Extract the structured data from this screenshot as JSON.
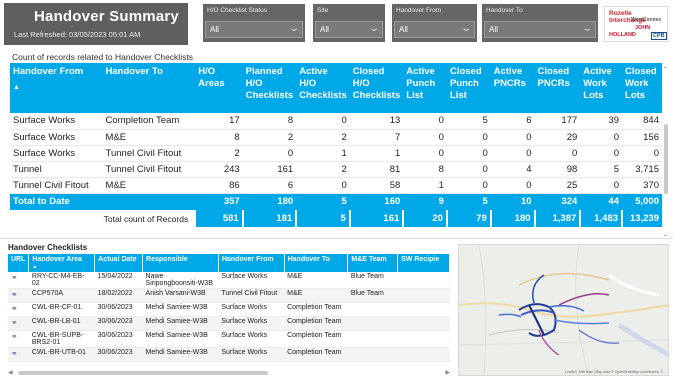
{
  "header": {
    "title": "Handover Summary",
    "last_refreshed": "Last Refreshed: 03/05/2023 05:01 AM",
    "filters": [
      {
        "label": "H/O Checklist Status",
        "value": "All"
      },
      {
        "label": "Site",
        "value": "All"
      },
      {
        "label": "Handover From",
        "value": "All"
      },
      {
        "label": "Handover To",
        "value": "All"
      }
    ],
    "logo": {
      "line1": "Rozelle Interchange",
      "line2": "WestConnex",
      "line3": "JOHN",
      "line4": "HOLLAND",
      "line5": "CPB"
    }
  },
  "summary": {
    "section_title": "Count of records related to Handover Checklists",
    "columns": [
      "Handover From",
      "Handover To",
      "H/O Areas",
      "Planned H/O Checklists",
      "Active H/O Checklists",
      "Closed H/O Checklists",
      "Active Punch List",
      "Closed Punch List",
      "Active PNCRs",
      "Closed PNCRs",
      "Active Work Lots",
      "Closed Work Lots"
    ],
    "rows": [
      [
        "Surface Works",
        "Completion Team",
        "17",
        "8",
        "0",
        "13",
        "0",
        "5",
        "6",
        "177",
        "39",
        "844"
      ],
      [
        "Surface Works",
        "M&E",
        "8",
        "2",
        "2",
        "7",
        "0",
        "0",
        "0",
        "29",
        "0",
        "156"
      ],
      [
        "Surface Works",
        "Tunnel Civil Fitout",
        "2",
        "0",
        "1",
        "1",
        "0",
        "0",
        "0",
        "0",
        "0",
        "0"
      ],
      [
        "Tunnel",
        "Tunnel Civil Fitout",
        "243",
        "161",
        "2",
        "81",
        "8",
        "0",
        "4",
        "98",
        "5",
        "3,715"
      ],
      [
        "Tunnel Civil Fitout",
        "M&E",
        "86",
        "6",
        "0",
        "58",
        "1",
        "0",
        "0",
        "25",
        "0",
        "370"
      ]
    ],
    "total": [
      "Total to Date",
      "",
      "357",
      "180",
      "5",
      "160",
      "9",
      "5",
      "10",
      "324",
      "44",
      "5,000"
    ],
    "count_label": "Total count of Records",
    "count": [
      "581",
      "181",
      "5",
      "161",
      "20",
      "79",
      "180",
      "1,387",
      "1,483",
      "13,239"
    ]
  },
  "checklists": {
    "section_title": "Handover Checklists",
    "columns": [
      "URL",
      "Handover Area",
      "Actual Date",
      "Responsible",
      "Handover From",
      "Handover To",
      "M&E Team",
      "SW Recipie"
    ],
    "rows": [
      [
        "RRY-CC-M4-EB-02",
        "15/04/2022",
        "Nawe Siripongboonsiti-W3B",
        "Surface Works",
        "M&E",
        "Blue Team",
        ""
      ],
      [
        "CCP570A",
        "18/02/2022",
        "Anish Varsani-W3B",
        "Tunnel Civil Fitout",
        "M&E",
        "Blue Team",
        ""
      ],
      [
        "CWL-BR-CF-01",
        "30/06/2023",
        "Mehdi Samiee-W3B",
        "Surface Works",
        "Completion Team",
        "",
        ""
      ],
      [
        "CWL-BR-LB-01",
        "30/06/2023",
        "Mehdi Samiee-W3B",
        "Surface Works",
        "Completion Team",
        "",
        ""
      ],
      [
        "CWL-BR-SUPB-BRS2-01",
        "30/06/2023",
        "Mehdi Samiee-W3B",
        "Surface Works",
        "Completion Team",
        "",
        ""
      ],
      [
        "CWL-BR-UTB-01",
        "30/06/2023",
        "Mehdi Samiee-W3B",
        "Surface Works",
        "Completion Team",
        "",
        ""
      ]
    ]
  },
  "map": {
    "attribution": "Leaflet | Jetti Map | Map data © OpenStreetMap contributors, ©..."
  },
  "colors": {
    "accent": "#00a8e8",
    "header_bg": "#5f5f5f",
    "filter_bg": "#666666"
  }
}
